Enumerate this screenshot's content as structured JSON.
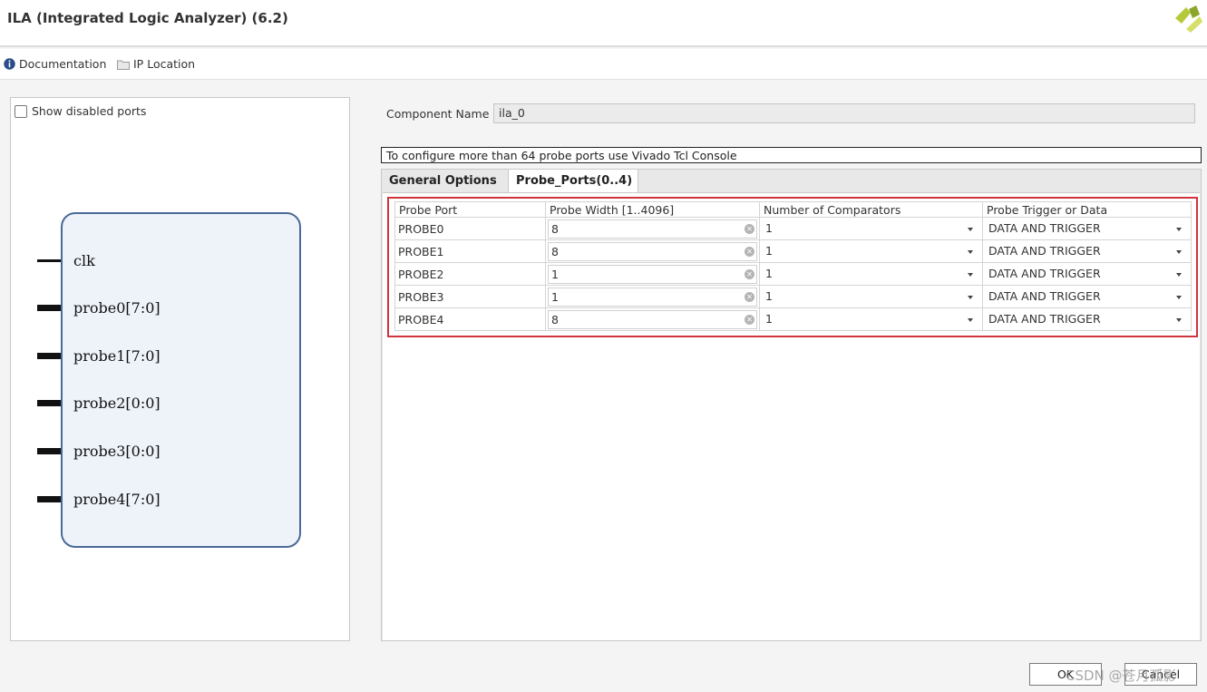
{
  "window": {
    "title": "ILA (Integrated Logic Analyzer) (6.2)"
  },
  "toolbar": {
    "documentation_label": "Documentation",
    "ip_location_label": "IP Location"
  },
  "left_panel": {
    "show_disabled_label": "Show disabled ports",
    "show_disabled_checked": false,
    "ports": [
      "clk",
      "probe0[7:0]",
      "probe1[7:0]",
      "probe2[0:0]",
      "probe3[0:0]",
      "probe4[7:0]"
    ]
  },
  "component": {
    "label": "Component Name",
    "value": "ila_0"
  },
  "info_text": "To configure more than 64 probe ports use Vivado Tcl Console",
  "tabs": [
    {
      "label": "General Options",
      "active": false
    },
    {
      "label": "Probe_Ports(0..4)",
      "active": true
    }
  ],
  "probe_table": {
    "headers": [
      "Probe Port",
      "Probe Width [1..4096]",
      "Number of Comparators",
      "Probe Trigger or Data"
    ],
    "rows": [
      {
        "port": "PROBE0",
        "width": "8",
        "comparators": "1",
        "type": "DATA AND TRIGGER"
      },
      {
        "port": "PROBE1",
        "width": "8",
        "comparators": "1",
        "type": "DATA AND TRIGGER"
      },
      {
        "port": "PROBE2",
        "width": "1",
        "comparators": "1",
        "type": "DATA AND TRIGGER"
      },
      {
        "port": "PROBE3",
        "width": "1",
        "comparators": "1",
        "type": "DATA AND TRIGGER"
      },
      {
        "port": "PROBE4",
        "width": "8",
        "comparators": "1",
        "type": "DATA AND TRIGGER"
      }
    ]
  },
  "buttons": {
    "ok": "OK",
    "cancel": "Cancel"
  },
  "watermark": "CSDN @苍月孤影",
  "colors": {
    "highlight_outline": "#d0343d",
    "block_border": "#4a6a98",
    "block_fill": "#eef3fa"
  }
}
